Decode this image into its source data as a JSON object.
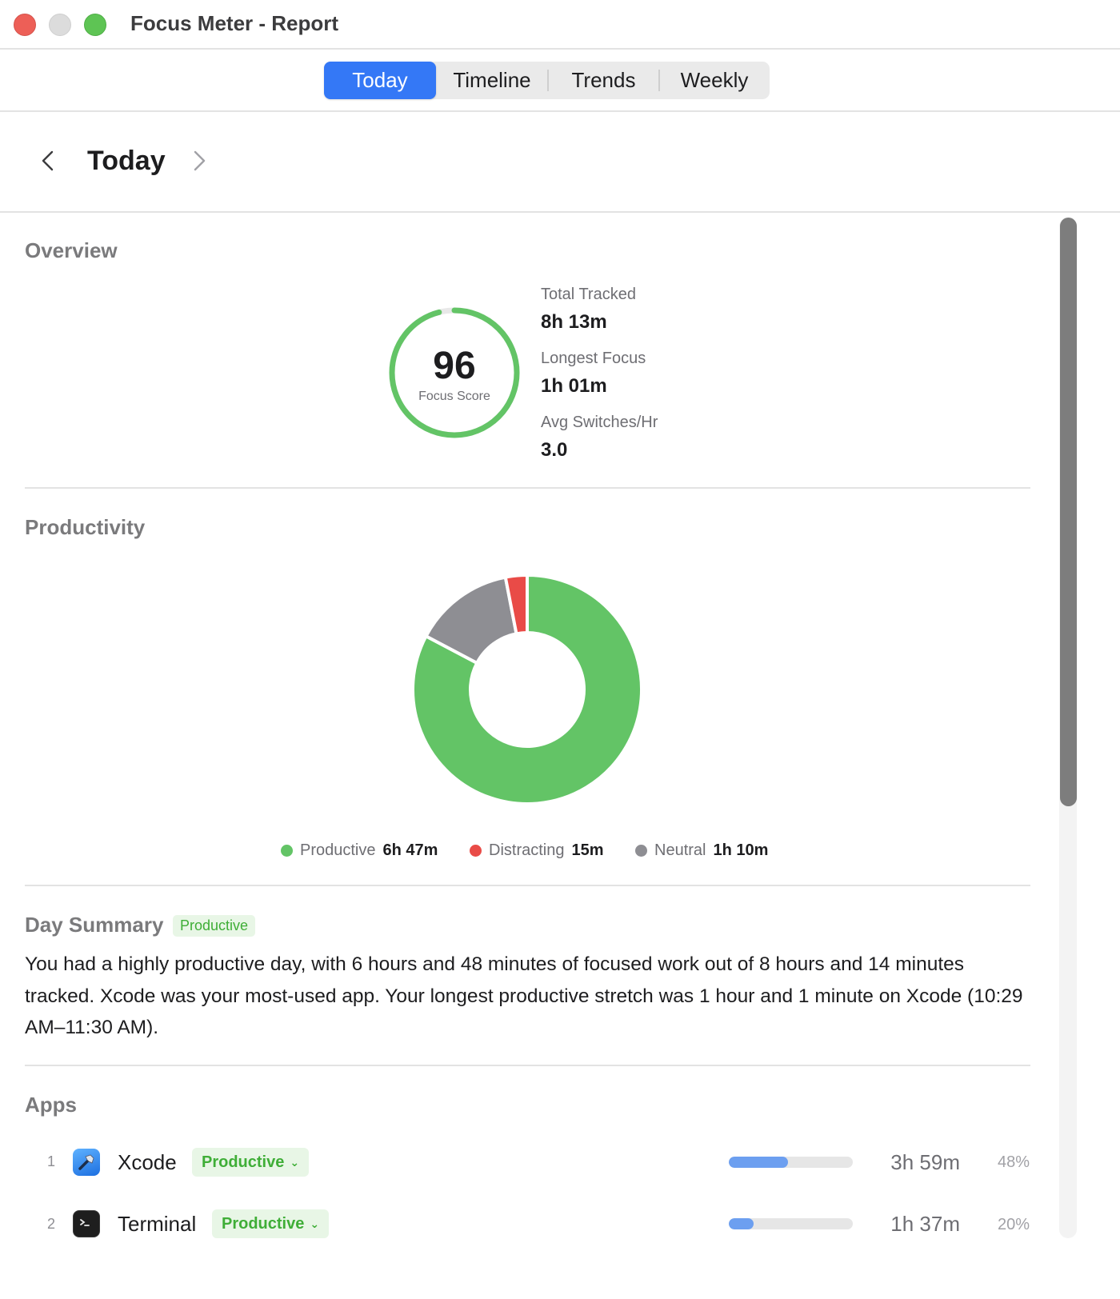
{
  "window": {
    "title": "Focus Meter - Report"
  },
  "tabs": [
    {
      "label": "Today",
      "active": true
    },
    {
      "label": "Timeline",
      "active": false
    },
    {
      "label": "Trends",
      "active": false
    },
    {
      "label": "Weekly",
      "active": false
    }
  ],
  "date_header": {
    "title": "Today",
    "prev_icon": "chevron-left-icon",
    "next_icon": "chevron-right-icon"
  },
  "overview": {
    "section_title": "Overview",
    "focus_score": {
      "value": "96",
      "label": "Focus Score",
      "fraction": 0.96
    },
    "stats": [
      {
        "label": "Total Tracked",
        "value": "8h 13m"
      },
      {
        "label": "Longest Focus",
        "value": "1h 01m"
      },
      {
        "label": "Avg Switches/Hr",
        "value": "3.0"
      }
    ]
  },
  "productivity": {
    "section_title": "Productivity",
    "legend": [
      {
        "name": "Productive",
        "value": "6h 47m",
        "color": "#63c466"
      },
      {
        "name": "Distracting",
        "value": "15m",
        "color": "#e94b47"
      },
      {
        "name": "Neutral",
        "value": "1h 10m",
        "color": "#8e8e93"
      }
    ]
  },
  "chart_data": {
    "type": "pie",
    "categories": [
      "Productive",
      "Distracting",
      "Neutral"
    ],
    "values": [
      407,
      15,
      70
    ],
    "units": "minutes",
    "colors": [
      "#63c466",
      "#e94b47",
      "#8e8e93"
    ],
    "donut": true,
    "title": ""
  },
  "day_summary": {
    "section_title": "Day Summary",
    "badge": "Productive",
    "text": "You had a highly productive day, with 6 hours and 48 minutes of focused work out of 8 hours and 14 minutes tracked. Xcode was your most-used app. Your longest productive stretch was 1 hour and 1 minute on Xcode (10:29 AM–11:30 AM)."
  },
  "apps": {
    "section_title": "Apps",
    "items": [
      {
        "rank": "1",
        "name": "Xcode",
        "icon": "xcode-hammer-icon",
        "category": "Productive",
        "time": "3h 59m",
        "percent": "48%",
        "share": 0.48
      },
      {
        "rank": "2",
        "name": "Terminal",
        "icon": "terminal-prompt-icon",
        "category": "Productive",
        "time": "1h 37m",
        "percent": "20%",
        "share": 0.2
      }
    ]
  },
  "colors": {
    "accent": "#3478f6",
    "productive": "#63c466",
    "distracting": "#e94b47",
    "neutral": "#8e8e93",
    "bar": "#6c9ff0"
  }
}
